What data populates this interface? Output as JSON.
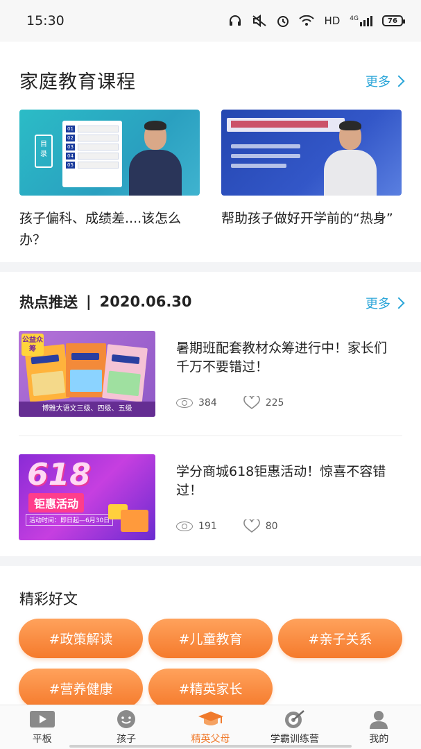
{
  "status_bar": {
    "time": "15:30",
    "network": "HD",
    "signal_label": "4G",
    "battery": "76"
  },
  "courses": {
    "title": "家庭教育课程",
    "more": "更多",
    "items": [
      {
        "title": "孩子偏科、成绩差....该怎么办？",
        "thumb_label": "目录"
      },
      {
        "title": "帮助孩子做好开学前的“热身”",
        "thumb_label": "帮助孩子做好开学前的“热身”"
      }
    ]
  },
  "hot": {
    "title": "热点推送",
    "separator": "|",
    "date": "2020.06.30",
    "more": "更多",
    "items": [
      {
        "title": "暑期班配套教材众筹进行中！家长们千万不要错过！",
        "views": "384",
        "likes": "225",
        "badge": "公益众筹",
        "caption": "博雅大语文三级、四级、五级"
      },
      {
        "title": "学分商城618钜惠活动！惊喜不容错过！",
        "views": "191",
        "likes": "80",
        "big_text": "618",
        "sub_text": "钜惠活动",
        "date_text": "活动时间：即日起—6月30日"
      }
    ]
  },
  "articles": {
    "title": "精彩好文",
    "tags": [
      "#政策解读",
      "#儿童教育",
      "#亲子关系",
      "#营养健康",
      "#精英家长"
    ]
  },
  "tabbar": {
    "items": [
      {
        "label": "平板",
        "icon": "tablet-play-icon"
      },
      {
        "label": "孩子",
        "icon": "child-face-icon"
      },
      {
        "label": "精英父母",
        "icon": "graduation-cap-icon",
        "active": true
      },
      {
        "label": "学霸训练营",
        "icon": "target-icon"
      },
      {
        "label": "我的",
        "icon": "profile-icon"
      }
    ]
  },
  "colors": {
    "accent_blue": "#2aa5d8",
    "accent_orange": "#f07a2c"
  }
}
